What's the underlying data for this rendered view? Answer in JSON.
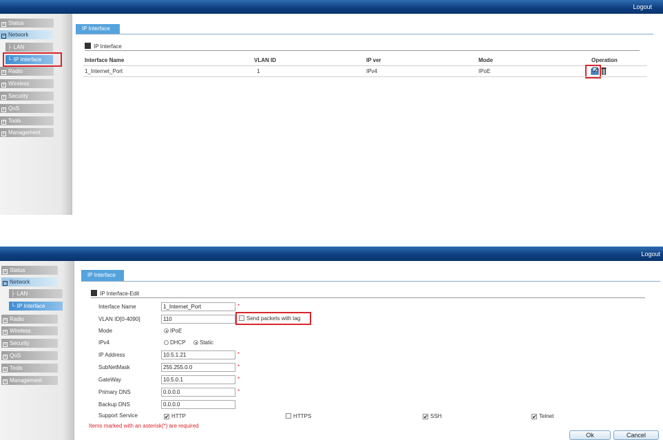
{
  "header": {
    "logout_label": "Logout"
  },
  "sidebar": {
    "items": [
      {
        "label": "Status"
      },
      {
        "label": "Network"
      },
      {
        "label": "LAN"
      },
      {
        "label": "IP Interface"
      },
      {
        "label": "Radio"
      },
      {
        "label": "Wireless"
      },
      {
        "label": "Security"
      },
      {
        "label": "QoS"
      },
      {
        "label": "Tools"
      },
      {
        "label": "Management"
      }
    ],
    "expander_collapsed": "+",
    "expander_open": "−",
    "tree_glyph": "├",
    "tree_glyph_last": "└"
  },
  "list_view": {
    "tab": "IP Interface",
    "section_title": "IP Interface",
    "columns": [
      "Interface Name",
      "VLAN ID",
      "IP ver",
      "Mode",
      "Operation"
    ],
    "rows": [
      {
        "interface_name": "1_Internet_Port",
        "vlan_id": "1",
        "ip_ver": "IPv4",
        "mode": "IPoE",
        "operation_icons": [
          "edit-icon",
          "delete-icon"
        ]
      }
    ]
  },
  "edit_view": {
    "tab": "IP Interface",
    "section_title": "IP Interface-Edit",
    "fields": {
      "interface_name": {
        "label": "Interface Name",
        "value": "1_Internet_Port"
      },
      "vlan_id": {
        "label": "VLAN ID[0-4090]",
        "value": "110",
        "send_tag_label": "Send packets with tag",
        "send_tag_checked": false
      },
      "mode": {
        "label": "Mode",
        "option": "IPoE",
        "selected": true
      },
      "ipv4": {
        "label": "IPv4",
        "options": [
          "DHCP",
          "Static"
        ],
        "selected": "Static"
      },
      "ip_address": {
        "label": "IP Address",
        "value": "10.5.1.21"
      },
      "subnet_mask": {
        "label": "SubNetMask",
        "value": "255.255.0.0"
      },
      "gateway": {
        "label": "GateWay",
        "value": "10.5.0.1"
      },
      "primary_dns": {
        "label": "Primary DNS",
        "value": "0.0.0.0"
      },
      "backup_dns": {
        "label": "Backup DNS",
        "value": "0.0.0.0"
      },
      "support_service": {
        "label": "Support Service",
        "options": [
          {
            "name": "HTTP",
            "checked": true
          },
          {
            "name": "HTTPS",
            "checked": false
          },
          {
            "name": "SSH",
            "checked": true
          },
          {
            "name": "Telnet",
            "checked": true
          }
        ]
      }
    },
    "asterisk": "*",
    "required_note": "Items marked with an asterisk(*) are required",
    "ok_label": "Ok",
    "cancel_label": "Cancel",
    "check_mark": "✔"
  },
  "colors": {
    "header": "#0f3f80",
    "tab": "#55a3dd",
    "highlight": "#d9252c"
  }
}
